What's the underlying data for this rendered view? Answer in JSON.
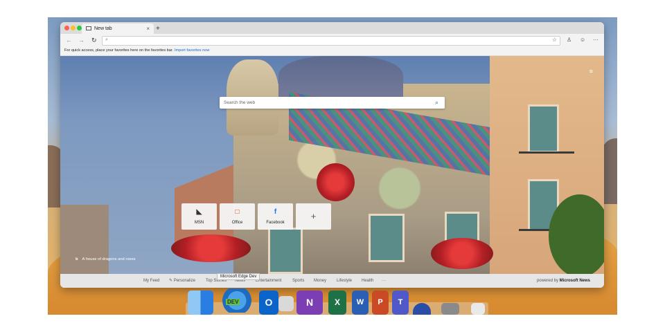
{
  "window": {
    "tab_title": "New tab",
    "tab_close": "×",
    "new_tab": "+"
  },
  "toolbar": {
    "back": "←",
    "forward": "→",
    "refresh": "↻",
    "search_glyph": "⌕",
    "star": "☆",
    "profile": "♙",
    "emoji": "☺",
    "more": "···"
  },
  "favorites_bar": {
    "message": "For quick access, place your favorites here on the favorites bar.",
    "import_link": "Import favorites now"
  },
  "search": {
    "placeholder": "Search the web",
    "icon": "⌕"
  },
  "quick_links": [
    {
      "label": "MSN",
      "icon_glyph": "◣",
      "color": "#333333"
    },
    {
      "label": "Office",
      "icon_glyph": "□",
      "color": "#d83b01"
    },
    {
      "label": "Facebook",
      "icon_glyph": "f",
      "color": "#1877f2"
    },
    {
      "label": "",
      "icon_glyph": "+",
      "color": "#555555"
    }
  ],
  "image_credit": {
    "logo": "b",
    "text": "A house of dragons and roses"
  },
  "news_bar": {
    "items": [
      "My Feed",
      "✎ Personalize",
      "Top Stories",
      "News",
      "Entertainment",
      "Sports",
      "Money",
      "Lifestyle",
      "Health",
      "···"
    ],
    "powered_prefix": "powered by",
    "powered_brand": "Microsoft News"
  },
  "tooltip": "Microsoft Edge Dev",
  "menu_icon": "≡",
  "dock": {
    "dev_badge": "DEV",
    "outlook": "O",
    "onenote": "N",
    "excel": "X",
    "word": "W",
    "powerpoint": "P",
    "teams": "T"
  }
}
